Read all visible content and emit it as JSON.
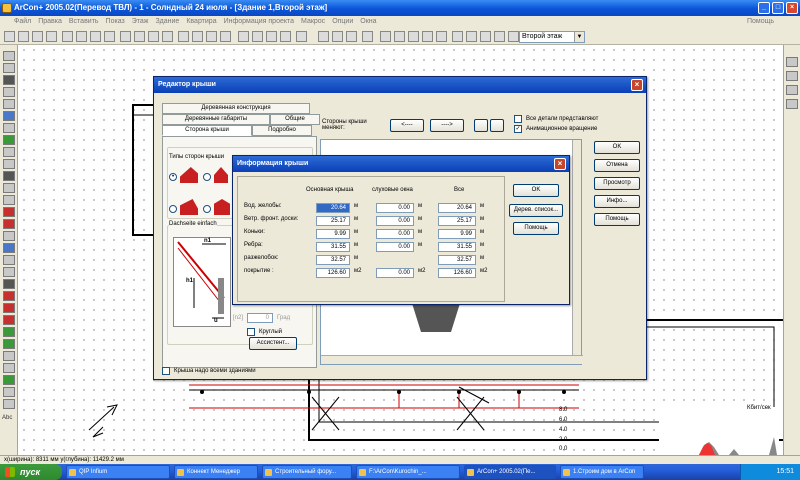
{
  "app": {
    "title": "ArCon+ 2005.02(Перевод ТВЛ) - 1 - Солндный 24 июля - [Здание 1,Второй этаж]",
    "menu": [
      "Файл",
      "Правка",
      "Вставить",
      "Показ",
      "Этаж",
      "Здание",
      "Квартира",
      "Информация проекта",
      "Макрос",
      "Опции",
      "Окна"
    ],
    "menu_help": "Помощь",
    "floor_select": "Второй этаж",
    "status_coords": "x(ширина): 8311 мм y(глубина): 11429.2 мм",
    "left_abc": "Abc",
    "right_label": "Кбит/сек"
  },
  "roof_editor": {
    "title": "Редактор крыши",
    "tabs_row1": [
      "Деревянная конструкция"
    ],
    "tabs_row2": [
      "Деревянные габариты",
      "Общие"
    ],
    "tabs_row3": [
      "Сторона крыши",
      "Подробно"
    ],
    "sides_change_label": "Стороны крыши меняют:",
    "arrow_left": "<----",
    "arrow_right": "---->",
    "chk_all_details": "Все детали представляют",
    "chk_anim_rotation": "Анимационное вращение",
    "group_types": "Типы сторон крыши",
    "group_dachseite": "Dachseite einfach",
    "n1": "n1",
    "h1": "h1",
    "u": "ü",
    "field_n2_unit": "[n2]",
    "field_n2_value": "0",
    "field_n2_deg": "Град",
    "chk_round": "Круглый",
    "assistant_btn": "Ассистент...",
    "chk_above_buildings": "Крыша надо всеми зданиями",
    "ok": "OK",
    "cancel": "Отмена",
    "view": "Просмотр",
    "info": "Инфо...",
    "help": "Помощь"
  },
  "roof_info": {
    "title": "Информация крыши",
    "col_main": "Основная крыша",
    "col_dormers": "слуховые окна",
    "col_all": "Все",
    "rows": [
      {
        "label": "Вод. желобы:",
        "main": "20.64",
        "dormers": "0.00",
        "all": "20.64",
        "unit": "м"
      },
      {
        "label": "Ветр. фронт. доски:",
        "main": "25.17",
        "dormers": "0.00",
        "all": "25.17",
        "unit": "м"
      },
      {
        "label": "Коньки:",
        "main": "9.99",
        "dormers": "0.00",
        "all": "9.99",
        "unit": "м"
      },
      {
        "label": "Ребра:",
        "main": "31.55",
        "dormers": "0.00",
        "all": "31.55",
        "unit": "м"
      },
      {
        "label": "разжелобок:",
        "main": "32.57",
        "dormers": "",
        "all": "32.57",
        "unit": "м"
      },
      {
        "label": "покрытие :",
        "main": "126.60",
        "dormers": "0.00",
        "all": "126.60",
        "unit": "м2"
      }
    ],
    "ok": "OK",
    "wood_list": "Дерев. список...",
    "help": "Помощь"
  },
  "taskbar": {
    "start": "пуск",
    "tasks": [
      "QIP Infium",
      "Коннект Менеджер",
      "Строительный фору...",
      "F:\\ArCon\\Kurochin_...",
      "ArCon+ 2005.02(Пе...",
      "1.Строим дом в ArCon"
    ],
    "clock": "15:51"
  },
  "net_graph": {
    "labels": [
      "8.0",
      "6.0",
      "4.0",
      "2.0",
      "0.0"
    ]
  }
}
